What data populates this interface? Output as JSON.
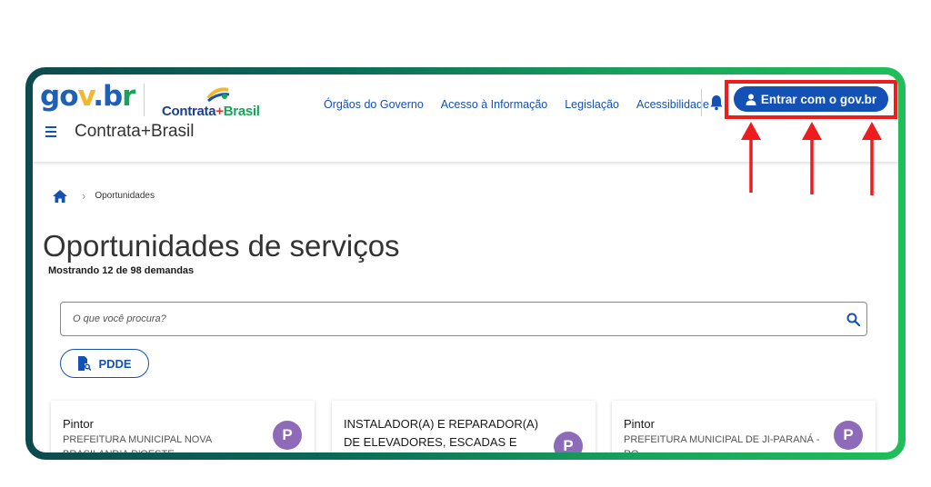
{
  "header": {
    "logo_gov_parts": [
      "go",
      "v",
      ".b",
      "r"
    ],
    "logo_contrata_parts": [
      "Contrata",
      "+",
      "Brasil"
    ],
    "nav": [
      "Órgãos do Governo",
      "Acesso à Informação",
      "Legislação",
      "Acessibilidade"
    ],
    "login_label": "Entrar com o gov.br",
    "app_title": "Contrata+Brasil"
  },
  "breadcrumb": {
    "current": "Oportunidades"
  },
  "page": {
    "title": "Oportunidades de serviços",
    "subtitle": "Mostrando 12 de 98 demandas"
  },
  "search": {
    "placeholder": "O que você procura?"
  },
  "filter": {
    "label": "PDDE"
  },
  "cards": [
    {
      "title": "Pintor",
      "org": "PREFEITURA MUNICIPAL NOVA BRASILANDIA D'OESTE",
      "avatar": "P"
    },
    {
      "title": "INSTALADOR(A) E REPARADOR(A) DE ELEVADORES, ESCADAS E",
      "org": "",
      "avatar": "P"
    },
    {
      "title": "Pintor",
      "org": "PREFEITURA MUNICIPAL DE JI-PARANÁ - RO",
      "avatar": "P"
    }
  ],
  "colors": {
    "primary": "#1351b4",
    "highlight": "#ee1c1c",
    "avatar": "#8e6bb8",
    "frame_gradient_start": "#0d4a4e",
    "frame_gradient_end": "#1fbf5a"
  }
}
